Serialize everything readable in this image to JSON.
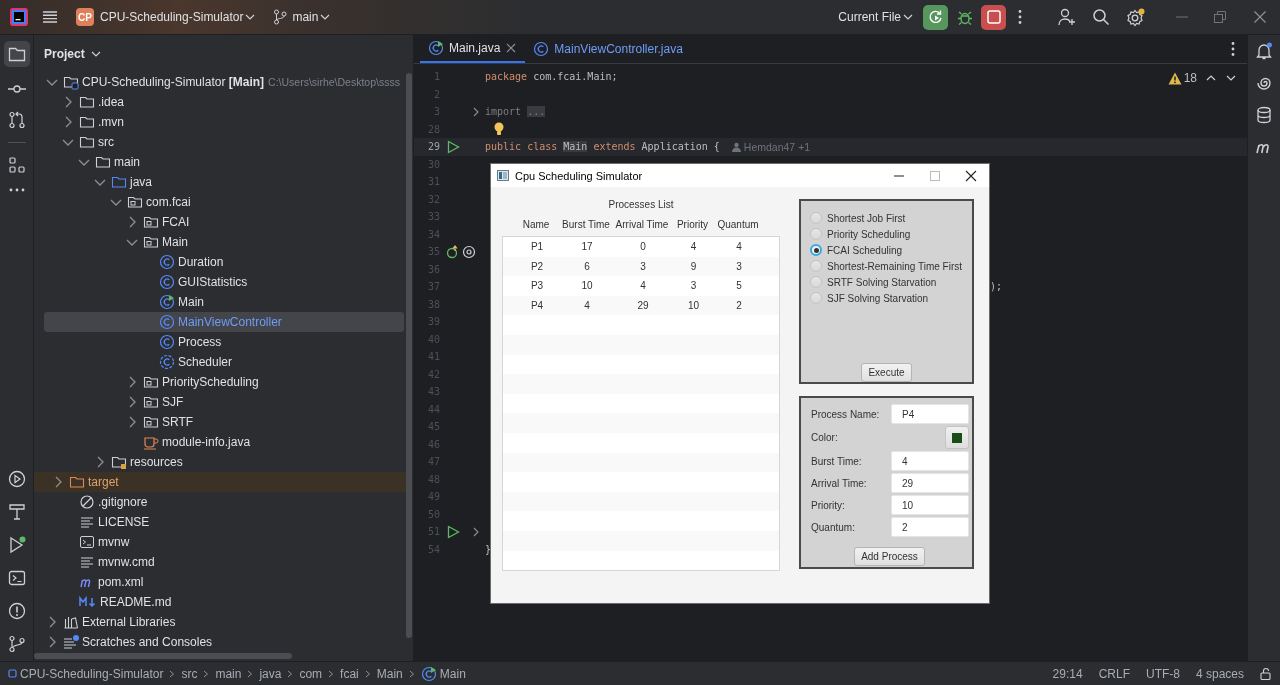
{
  "title_bar": {
    "project_badge": "CP",
    "project": "CPU-Scheduling-Simulator",
    "branch": "main",
    "run_config": "Current File"
  },
  "project_panel": {
    "title": "Project",
    "tree": [
      {
        "label": "CPU-Scheduling-Simulator **[Main]**",
        "hint": "C:\\Users\\sirhe\\Desktop\\ssss",
        "kind": "module",
        "expanded": true,
        "selected": false,
        "children": [
          {
            "label": ".idea",
            "kind": "folder",
            "expanded": false,
            "selected": false
          },
          {
            "label": ".mvn",
            "kind": "folder",
            "expanded": false,
            "selected": false
          },
          {
            "label": "src",
            "kind": "folder",
            "expanded": true,
            "selected": false,
            "children": [
              {
                "label": "main",
                "kind": "folder",
                "expanded": true,
                "selected": false,
                "children": [
                  {
                    "label": "java",
                    "kind": "source-folder",
                    "expanded": true,
                    "selected": false,
                    "children": [
                      {
                        "label": "com.fcai",
                        "kind": "package",
                        "expanded": true,
                        "selected": false,
                        "children": [
                          {
                            "label": "FCAI",
                            "kind": "package",
                            "expanded": false,
                            "selected": false
                          },
                          {
                            "label": "Main",
                            "kind": "package",
                            "expanded": true,
                            "selected": false,
                            "children": [
                              {
                                "label": "Duration",
                                "kind": "class",
                                "selected": false
                              },
                              {
                                "label": "GUIStatistics",
                                "kind": "class",
                                "selected": false
                              },
                              {
                                "label": "Main",
                                "kind": "main-class",
                                "selected": false
                              },
                              {
                                "label": "MainViewController",
                                "kind": "class",
                                "selected": true
                              },
                              {
                                "label": "Process",
                                "kind": "class",
                                "selected": false
                              },
                              {
                                "label": "Scheduler",
                                "kind": "abstract-class",
                                "selected": false
                              }
                            ]
                          },
                          {
                            "label": "PriorityScheduling",
                            "kind": "package",
                            "expanded": false,
                            "selected": false
                          },
                          {
                            "label": "SJF",
                            "kind": "package",
                            "expanded": false,
                            "selected": false
                          },
                          {
                            "label": "SRTF",
                            "kind": "package",
                            "expanded": false,
                            "selected": false
                          },
                          {
                            "label": "module-info.java",
                            "kind": "java-file",
                            "selected": false
                          }
                        ]
                      }
                    ]
                  },
                  {
                    "label": "resources",
                    "kind": "resources-folder",
                    "expanded": false,
                    "selected": false
                  }
                ]
              }
            ]
          },
          {
            "label": "target",
            "kind": "excluded-folder",
            "expanded": false,
            "selected": false
          },
          {
            "label": ".gitignore",
            "kind": "ignore-file",
            "selected": false
          },
          {
            "label": "LICENSE",
            "kind": "text-file",
            "selected": false
          },
          {
            "label": "mvnw",
            "kind": "script-file",
            "selected": false
          },
          {
            "label": "mvnw.cmd",
            "kind": "text-file",
            "selected": false
          },
          {
            "label": "pom.xml",
            "kind": "maven-file",
            "selected": false
          },
          {
            "label": "README.md",
            "kind": "markdown-file",
            "selected": false
          }
        ]
      },
      {
        "label": "External Libraries",
        "kind": "libraries",
        "expanded": false,
        "selected": false
      },
      {
        "label": "Scratches and Consoles",
        "kind": "scratches",
        "expanded": false,
        "selected": false
      }
    ]
  },
  "editor": {
    "tabs": [
      {
        "label": "Main.java",
        "kind": "main-class",
        "selected": true,
        "modified": false
      },
      {
        "label": "MainViewController.java",
        "kind": "class",
        "selected": false,
        "modified": true
      }
    ],
    "warnings": "18",
    "lines": [
      {
        "number": "1",
        "tokens": [
          {
            "text": "package",
            "kind": "keyword"
          },
          {
            "text": " com.fcai.Main;",
            "kind": "plain"
          }
        ]
      },
      {
        "number": "2"
      },
      {
        "number": "3",
        "fold": true,
        "tokens": [
          {
            "text": "import ",
            "kind": "muted"
          },
          {
            "text": "...",
            "kind": "folded"
          }
        ]
      },
      {
        "number": "28",
        "bulb": true
      },
      {
        "number": "29",
        "current": true,
        "runnable": true,
        "author": "Hemdan47 +1",
        "tokens": [
          {
            "text": "public class ",
            "kind": "keyword"
          },
          {
            "text": "Main",
            "kind": "usage"
          },
          {
            "text": " extends",
            "kind": "keyword"
          },
          {
            "text": " Application {",
            "kind": "plain"
          }
        ]
      },
      {
        "number": "30"
      },
      {
        "number": "31"
      },
      {
        "number": "32"
      },
      {
        "number": "33"
      },
      {
        "number": "34"
      },
      {
        "number": "35",
        "overrides": true
      },
      {
        "number": "36"
      },
      {
        "number": "37",
        "tokens": [
          {
            "text": ");",
            "kind": "tail"
          }
        ]
      },
      {
        "number": "38"
      },
      {
        "number": "39"
      },
      {
        "number": "40"
      },
      {
        "number": "41"
      },
      {
        "number": "42"
      },
      {
        "number": "43"
      },
      {
        "number": "44"
      },
      {
        "number": "45"
      },
      {
        "number": "46"
      },
      {
        "number": "47"
      },
      {
        "number": "48"
      },
      {
        "number": "49"
      },
      {
        "number": "50"
      },
      {
        "number": "51",
        "runnable": true,
        "fold": true
      },
      {
        "number": "54",
        "tokens": [
          {
            "text": "}",
            "kind": "plain"
          }
        ]
      }
    ]
  },
  "dialog": {
    "title": "Cpu Scheduling Simulator",
    "table": {
      "caption": "Processes List",
      "columns": [
        "Name",
        "Burst Time",
        "Arrival Time",
        "Priority",
        "Quantum"
      ],
      "rows": [
        [
          "P1",
          "17",
          "0",
          "4",
          "4"
        ],
        [
          "P2",
          "6",
          "3",
          "9",
          "3"
        ],
        [
          "P3",
          "10",
          "4",
          "3",
          "5"
        ],
        [
          "P4",
          "4",
          "29",
          "10",
          "2"
        ]
      ]
    },
    "algorithms": [
      {
        "label": "Shortest Job First",
        "selected": false
      },
      {
        "label": "Priority Scheduling",
        "selected": false
      },
      {
        "label": "FCAI Scheduling",
        "selected": true
      },
      {
        "label": "Shortest-Remaining Time First",
        "selected": false
      },
      {
        "label": "SRTF Solving Starvation",
        "selected": false
      },
      {
        "label": "SJF Solving Starvation",
        "selected": false
      }
    ],
    "execute_button": "Execute",
    "form": {
      "fields": [
        {
          "label": "Process Name:",
          "kind": "text",
          "value": "P4"
        },
        {
          "label": "Color:",
          "kind": "color",
          "color": "#1b4d1b"
        },
        {
          "label": "Burst Time:",
          "kind": "text",
          "value": "4"
        },
        {
          "label": "Arrival Time:",
          "kind": "text",
          "value": "29"
        },
        {
          "label": "Priority:",
          "kind": "text",
          "value": "10"
        },
        {
          "label": "Quantum:",
          "kind": "text",
          "value": "2"
        }
      ],
      "add_button": "Add Process"
    }
  },
  "status_bar": {
    "breadcrumbs": [
      {
        "label": "CPU-Scheduling-Simulator",
        "kind": "module"
      },
      {
        "label": "src",
        "kind": "plain"
      },
      {
        "label": "main",
        "kind": "plain"
      },
      {
        "label": "java",
        "kind": "plain"
      },
      {
        "label": "com",
        "kind": "plain"
      },
      {
        "label": "fcai",
        "kind": "plain"
      },
      {
        "label": "Main",
        "kind": "plain"
      },
      {
        "label": "Main",
        "kind": "main-class"
      }
    ],
    "position": "29:14",
    "line_ending": "CRLF",
    "encoding": "UTF-8",
    "indent": "4 spaces"
  }
}
